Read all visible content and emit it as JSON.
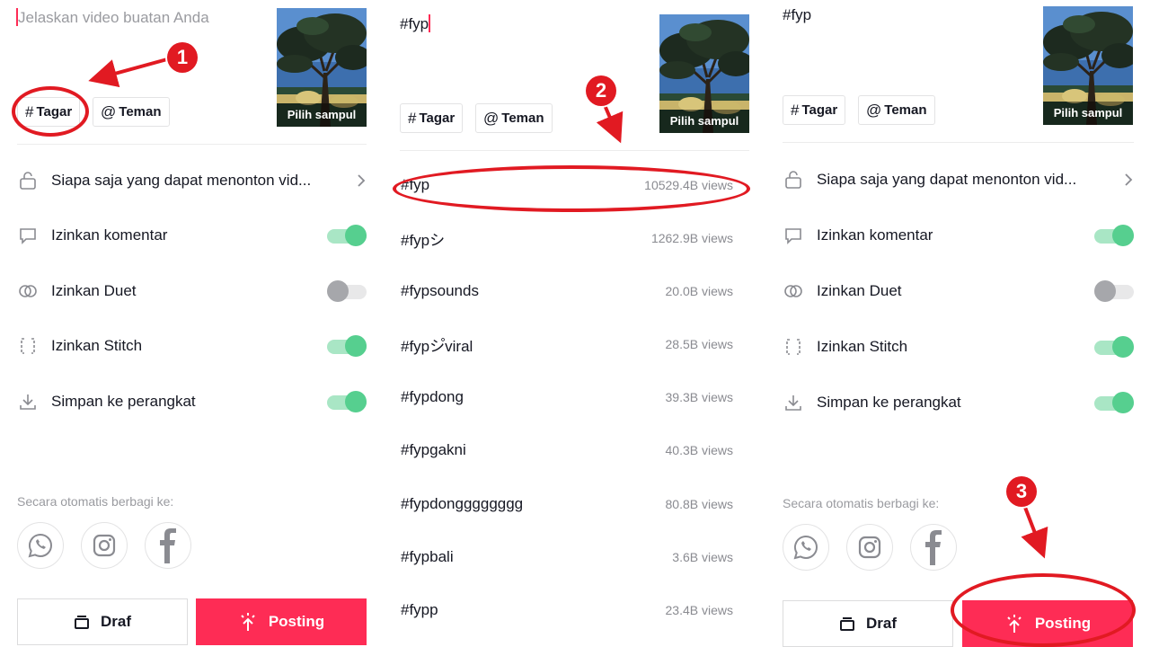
{
  "caption_placeholder": "Jelaskan video buatan Anda",
  "caption_typed": "#fyp",
  "cover_label": "Pilih sampul",
  "chips": {
    "hashtag": "Tagar",
    "mention": "Teman",
    "hashtag_symbol": "#",
    "mention_symbol": "@"
  },
  "settings": [
    {
      "label": "Siapa saja yang dapat menonton vid...",
      "icon": "lock-icon",
      "control": "chevron"
    },
    {
      "label": "Izinkan komentar",
      "icon": "comment-icon",
      "control": "toggle",
      "on": true
    },
    {
      "label": "Izinkan Duet",
      "icon": "duet-icon",
      "control": "toggle",
      "on": false
    },
    {
      "label": "Izinkan Stitch",
      "icon": "stitch-icon",
      "control": "toggle",
      "on": true
    },
    {
      "label": "Simpan ke perangkat",
      "icon": "download-icon",
      "control": "toggle",
      "on": true
    }
  ],
  "share_label": "Secara otomatis berbagi ke:",
  "share_icons": [
    "whatsapp-icon",
    "instagram-icon",
    "facebook-icon"
  ],
  "draft_label": "Draf",
  "post_label": "Posting",
  "suggestions": [
    {
      "tag": "#fyp",
      "views": "10529.4B views"
    },
    {
      "tag": "#fypシ",
      "views": "1262.9B views"
    },
    {
      "tag": "#fypsounds",
      "views": "20.0B views"
    },
    {
      "tag": "#fypシ゚viral",
      "views": "28.5B views"
    },
    {
      "tag": "#fypdong",
      "views": "39.3B views"
    },
    {
      "tag": "#fypgakni",
      "views": "40.3B views"
    },
    {
      "tag": "#fypdongggggggg",
      "views": "80.8B views"
    },
    {
      "tag": "#fypbali",
      "views": "3.6B views"
    },
    {
      "tag": "#fypp",
      "views": "23.4B views"
    }
  ],
  "steps": [
    "1",
    "2",
    "3"
  ],
  "colors": {
    "accent": "#fe2c55",
    "toggle_on": "#56cf8f",
    "toggle_off": "#a6a7ab",
    "annotation": "#e11a22"
  }
}
